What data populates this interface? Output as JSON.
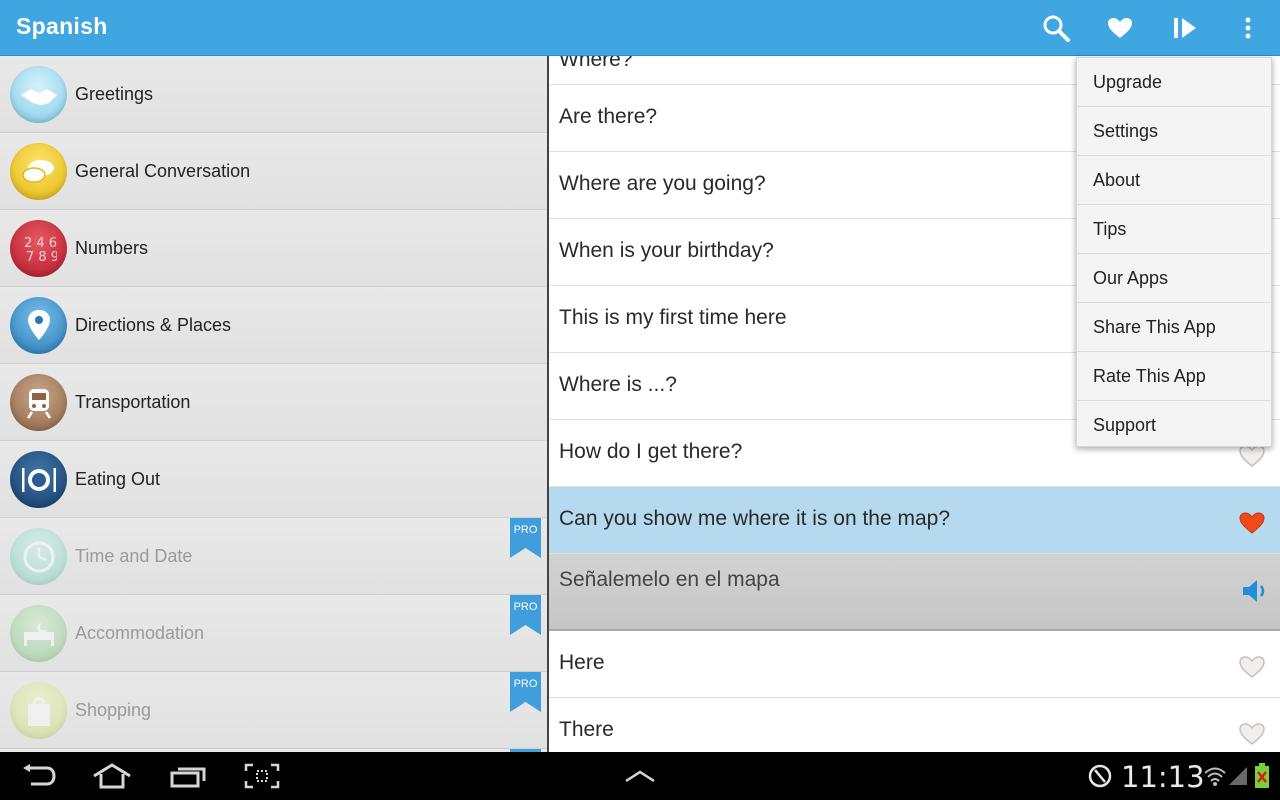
{
  "app": {
    "title": "Spanish"
  },
  "actionbar": {
    "icons": [
      "search-icon",
      "heart-icon",
      "play-next-icon",
      "overflow-menu-icon"
    ],
    "accent_color": "#3fa6e2"
  },
  "categories": [
    {
      "label": "Greetings",
      "icon": "handshake-icon",
      "locked": false
    },
    {
      "label": "General Conversation",
      "icon": "speech-bubbles-icon",
      "locked": false
    },
    {
      "label": "Numbers",
      "icon": "numbers-icon",
      "locked": false
    },
    {
      "label": "Directions & Places",
      "icon": "map-pin-icon",
      "locked": false
    },
    {
      "label": "Transportation",
      "icon": "train-icon",
      "locked": false
    },
    {
      "label": "Eating Out",
      "icon": "plate-cutlery-icon",
      "locked": false
    },
    {
      "label": "Time and Date",
      "icon": "clock-icon",
      "locked": true
    },
    {
      "label": "Accommodation",
      "icon": "bed-icon",
      "locked": true
    },
    {
      "label": "Shopping",
      "icon": "gift-bag-icon",
      "locked": true
    }
  ],
  "pro_badge": "PRO",
  "phrases": {
    "partial_top": "Where?",
    "items": [
      "Are there?",
      "Where are you going?",
      "When is your birthday?",
      "This is my first time here",
      "Where is ...?",
      "How do I get there?"
    ],
    "selected": "Can you show me where it is on the map?",
    "translation": "Señalemelo en el mapa",
    "after": [
      "Here",
      "There"
    ]
  },
  "menu": {
    "items": [
      "Upgrade",
      "Settings",
      "About",
      "Tips",
      "Our Apps",
      "Share This App",
      "Rate This App",
      "Support"
    ]
  },
  "statusbar": {
    "time": "11:13"
  }
}
